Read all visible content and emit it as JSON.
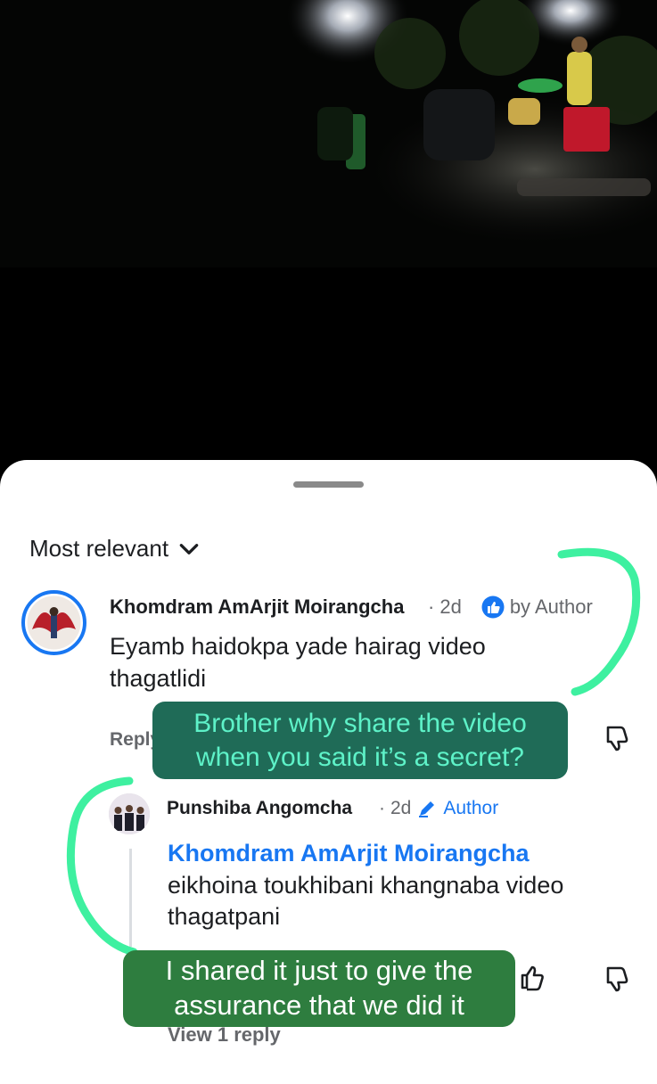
{
  "sheet": {
    "sort_label": "Most relevant"
  },
  "comments": [
    {
      "author": "Khomdram AmArjit Moirangcha",
      "time": "2d",
      "separator": "·",
      "badge": "by Author",
      "badge_icon": "thumbs-up-badge-icon",
      "text": "Eyamb haidokpa yade hairag video thagatlidi",
      "reply_label": "Reply"
    },
    {
      "author": "Punshiba Angomcha",
      "time": "2d",
      "separator": "·",
      "badge": "Author",
      "badge_icon": "pencil-icon",
      "mention": "Khomdram AmArjit Moirangcha",
      "text": "eikhoina toukhibani khangnaba video thagatpani",
      "view_replies_label": "View 1 reply"
    }
  ],
  "annotations": [
    {
      "text": "Brother why share the video when you said it’s a secret?",
      "color": "#5ef2c8",
      "bg": "#1f6b57"
    },
    {
      "text": "I shared it just to give the assurance that we did it",
      "color": "#ffffff",
      "bg": "#2e7d3f"
    }
  ],
  "colors": {
    "accent_blue": "#1877f2",
    "highlight_green": "#3ef0a0"
  }
}
